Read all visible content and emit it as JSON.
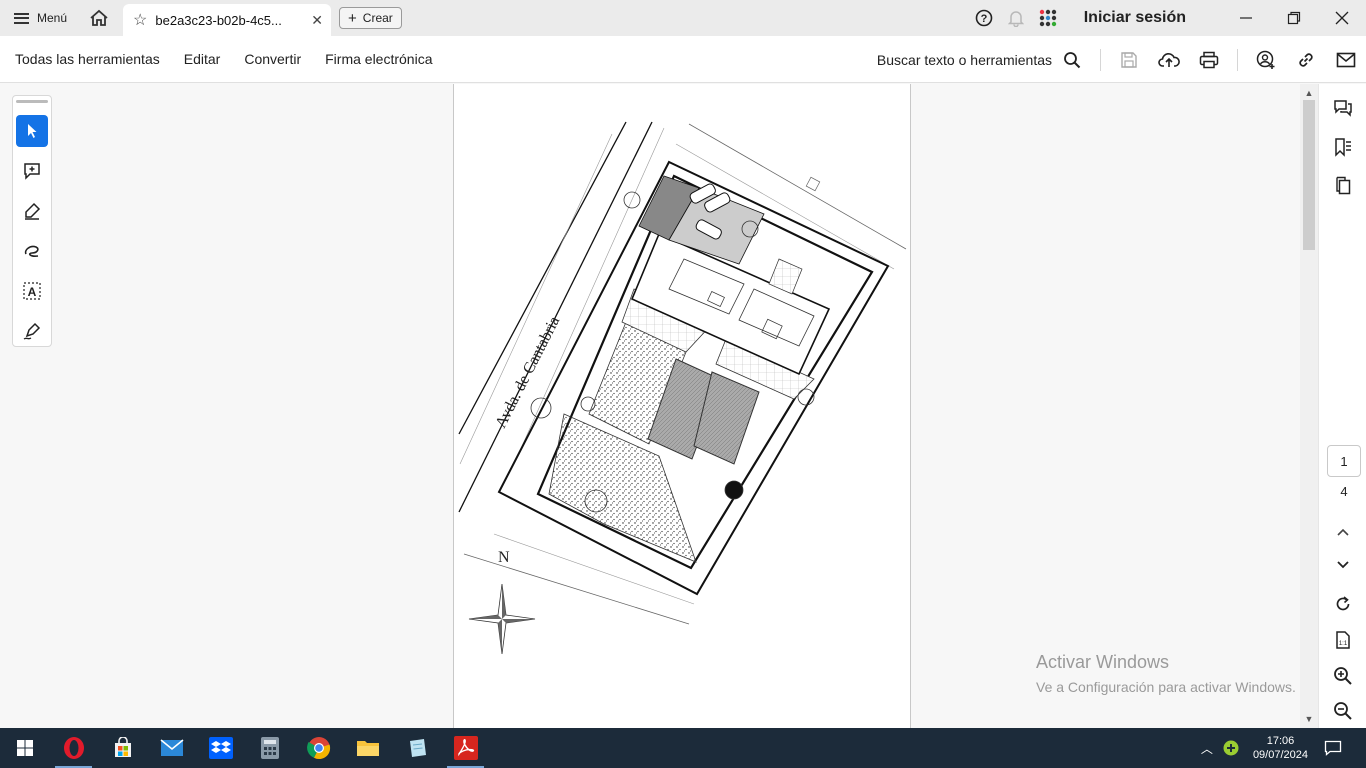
{
  "titlebar": {
    "menu_label": "Menú",
    "tab_title": "be2a3c23-b02b-4c5...",
    "create_label": "Crear",
    "signin_label": "Iniciar sesión"
  },
  "toolbar": {
    "items": [
      "Todas las herramientas",
      "Editar",
      "Convertir",
      "Firma electrónica"
    ],
    "search_label": "Buscar texto o herramientas"
  },
  "pager": {
    "current": "1",
    "total": "4"
  },
  "watermark": {
    "line1": "Activar Windows",
    "line2": "Ve a Configuración para activar Windows."
  },
  "drawing": {
    "street_label": "Avda. de Cantabria",
    "north_label": "N"
  },
  "clock": {
    "time": "17:06",
    "date": "09/07/2024"
  },
  "colors": {
    "accent": "#1473e6",
    "taskbar": "#1c2b3a",
    "acrobat_red": "#d7261e"
  }
}
